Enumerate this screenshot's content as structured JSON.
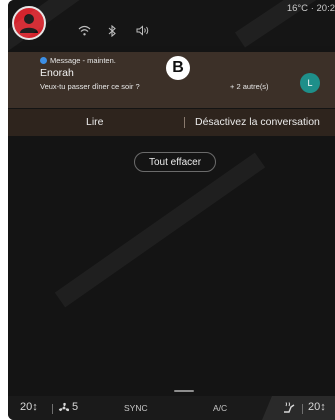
{
  "status": {
    "temperature": "16°C",
    "separator": "·",
    "time": "20:2"
  },
  "notification": {
    "app_name": "Message - mainten.",
    "sender": "Enorah",
    "message": "Veux-tu passer dîner ce soir ?",
    "others": "+ 2 autre(s)",
    "contact_initial": "L",
    "callout_label": "B"
  },
  "actions": {
    "read": "Lire",
    "disable": "Désactivez la conversation"
  },
  "clear_all": "Tout effacer",
  "climate": {
    "left_temp": "20↕",
    "fan_level": "5",
    "sync": "SYNC",
    "ac": "A/C",
    "right_temp": "20↕"
  },
  "colors": {
    "avatar": "#d3242d",
    "contact_avatar": "#1e8f8a",
    "app_dot": "#3c8fe6",
    "notification_bg": "#3c3028"
  },
  "icons": [
    "user-icon",
    "wifi-icon",
    "bluetooth-icon",
    "volume-icon",
    "fan-icon",
    "seat-heat-icon"
  ]
}
